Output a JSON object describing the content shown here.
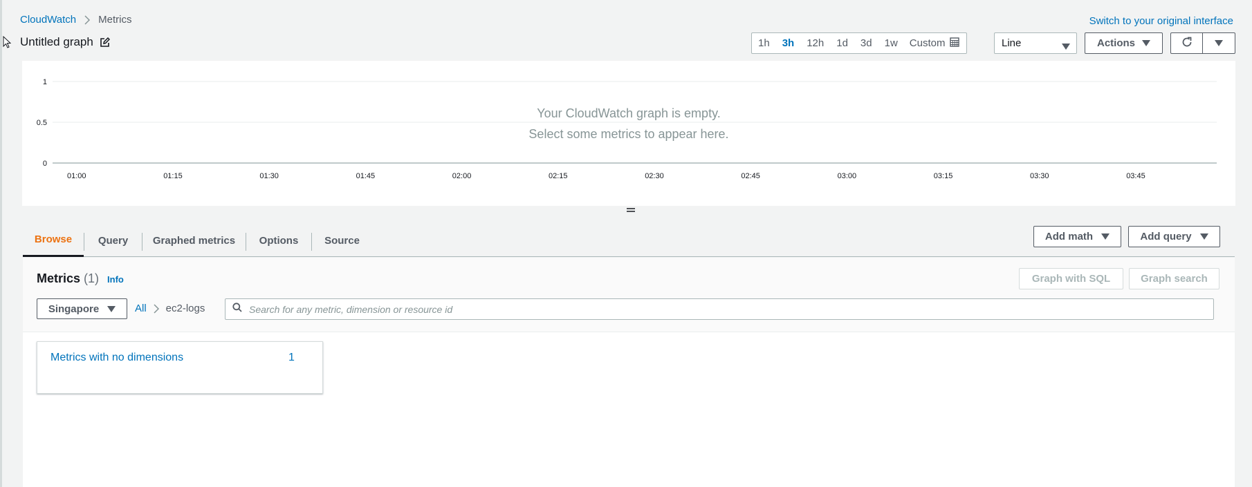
{
  "breadcrumb": {
    "root": "CloudWatch",
    "current": "Metrics"
  },
  "header": {
    "switch_link": "Switch to your original interface",
    "graph_title": "Untitled graph"
  },
  "time_range": {
    "options": [
      "1h",
      "3h",
      "12h",
      "1d",
      "3d",
      "1w"
    ],
    "selected": "3h",
    "custom_label": "Custom"
  },
  "chart_type": {
    "selected": "Line"
  },
  "toolbar": {
    "actions_label": "Actions"
  },
  "graph": {
    "empty_line1": "Your CloudWatch graph is empty.",
    "empty_line2": "Select some metrics to appear here."
  },
  "chart_data": {
    "type": "line",
    "series": [],
    "x_ticks": [
      "01:00",
      "01:15",
      "01:30",
      "01:45",
      "02:00",
      "02:15",
      "02:30",
      "02:45",
      "03:00",
      "03:15",
      "03:30",
      "03:45"
    ],
    "y_ticks": [
      "1",
      "0.5",
      "0"
    ],
    "ylim": [
      0,
      1
    ],
    "grid": true
  },
  "tabs": [
    {
      "label": "Browse",
      "active": true
    },
    {
      "label": "Query",
      "active": false
    },
    {
      "label": "Graphed metrics",
      "active": false
    },
    {
      "label": "Options",
      "active": false
    },
    {
      "label": "Source",
      "active": false
    }
  ],
  "tab_actions": {
    "add_math": "Add math",
    "add_query": "Add query"
  },
  "browse": {
    "title": "Metrics",
    "count": "(1)",
    "info": "Info",
    "graph_sql": "Graph with SQL",
    "graph_search": "Graph search",
    "region": "Singapore",
    "path_all": "All",
    "path_current": "ec2-logs",
    "search_placeholder": "Search for any metric, dimension or resource id",
    "cards": [
      {
        "name": "Metrics with no dimensions",
        "count": "1"
      }
    ]
  },
  "colors": {
    "link": "#0073bb",
    "active_tab": "#ec7211",
    "background": "#f2f3f3"
  }
}
